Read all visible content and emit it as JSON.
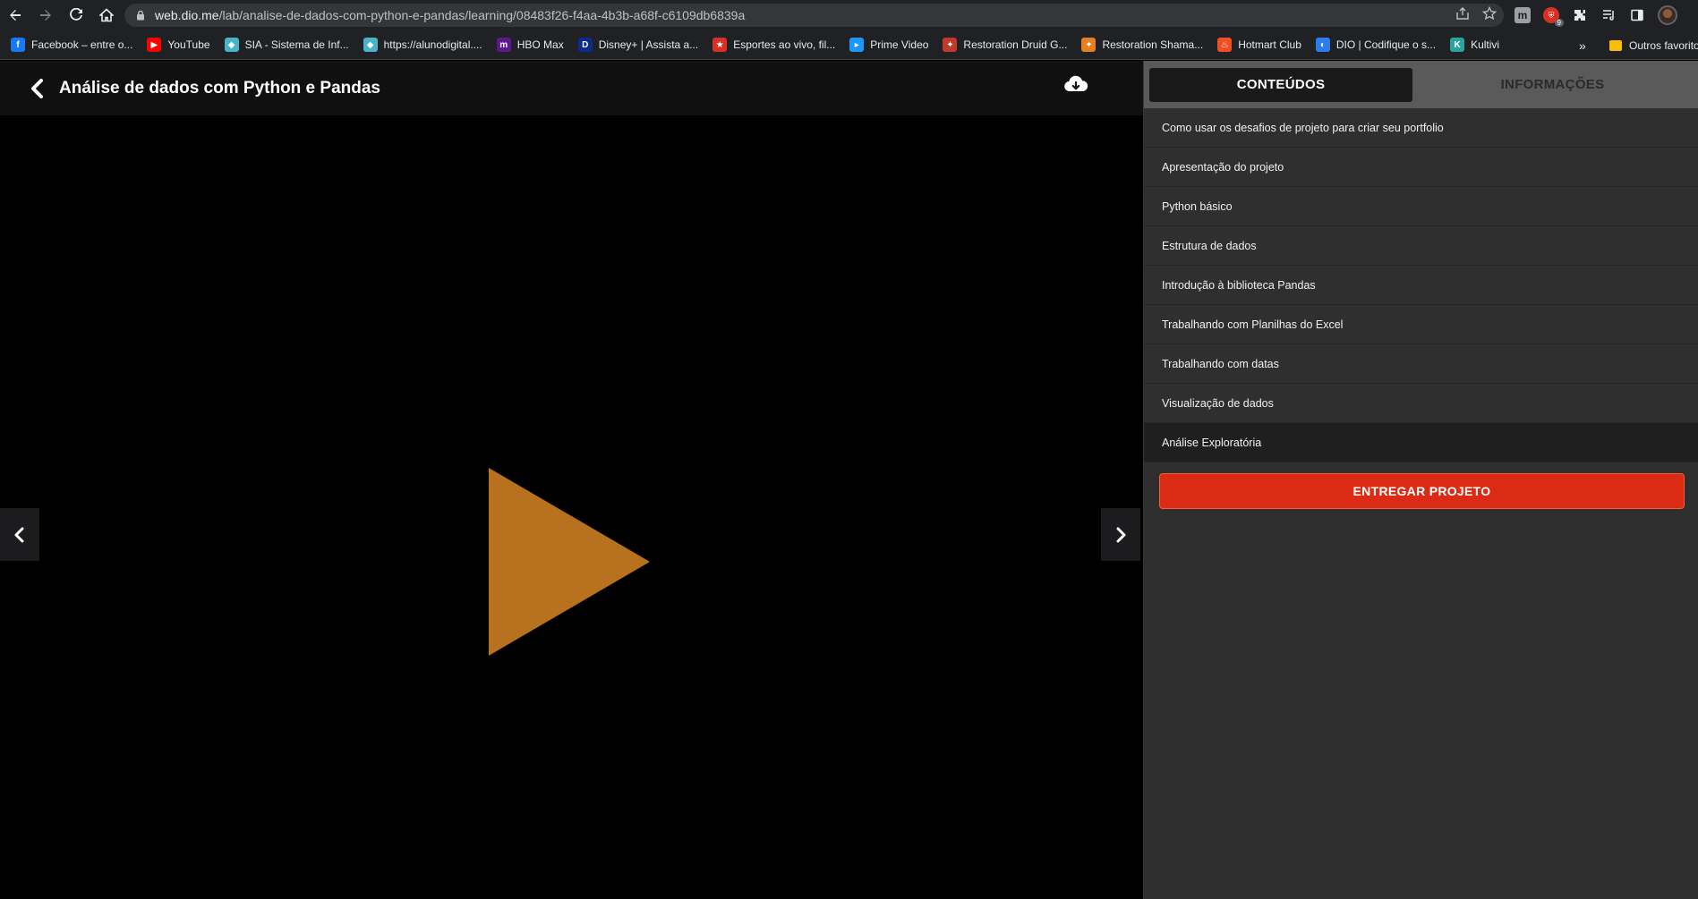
{
  "browser": {
    "url_host": "web.dio.me",
    "url_path": "/lab/analise-de-dados-com-python-e-pandas/learning/08483f26-f4aa-4b3b-a68f-c6109db6839a",
    "extension_badge": "9",
    "bookmarks": [
      {
        "label": "Facebook – entre o...",
        "color": "#1877f2",
        "glyph": "f"
      },
      {
        "label": "YouTube",
        "color": "#ff0000",
        "glyph": "▶"
      },
      {
        "label": "SIA - Sistema de Inf...",
        "color": "#4ab3c8",
        "glyph": "◆"
      },
      {
        "label": "https://alunodigital....",
        "color": "#4ab3c8",
        "glyph": "◆"
      },
      {
        "label": "HBO Max",
        "color": "#5b1a8c",
        "glyph": "m"
      },
      {
        "label": "Disney+ | Assista a...",
        "color": "#0b2a8c",
        "glyph": "D"
      },
      {
        "label": "Esportes ao vivo, fil...",
        "color": "#d93025",
        "glyph": "★"
      },
      {
        "label": "Prime Video",
        "color": "#1a98ff",
        "glyph": "▸"
      },
      {
        "label": "Restoration Druid G...",
        "color": "#c0392b",
        "glyph": "✦"
      },
      {
        "label": "Restoration Shama...",
        "color": "#e67e22",
        "glyph": "✦"
      },
      {
        "label": "Hotmart Club",
        "color": "#f04e23",
        "glyph": "♨"
      },
      {
        "label": "DIO | Codifique o s...",
        "color": "#2b7de9",
        "glyph": "◐"
      },
      {
        "label": "Kultivi",
        "color": "#2aa39b",
        "glyph": "K"
      }
    ],
    "bookmarks_more": "»",
    "other_bookmarks": "Outros favoritos"
  },
  "player": {
    "course_title": "Análise de dados com Python e Pandas",
    "play_color": "#b8711e"
  },
  "sidebar": {
    "tab_contents": "CONTEÚDOS",
    "tab_info": "INFORMAÇÕES",
    "lessons": [
      "Como usar os desafios de projeto para criar seu portfolio",
      "Apresentação do projeto",
      "Python básico",
      "Estrutura de dados",
      "Introdução à biblioteca Pandas",
      "Trabalhando com Planilhas do Excel",
      "Trabalhando com datas",
      "Visualização de dados",
      "Análise Exploratória"
    ],
    "selected_lesson": "Análise Exploratória",
    "submit_label": "ENTREGAR PROJETO"
  }
}
